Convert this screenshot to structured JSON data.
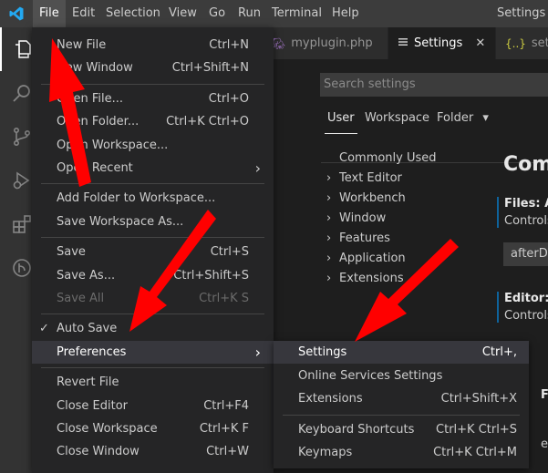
{
  "menubar": {
    "items": [
      "File",
      "Edit",
      "Selection",
      "View",
      "Go",
      "Run",
      "Terminal",
      "Help"
    ],
    "window_title": "Settings - "
  },
  "activity_bar": {
    "icons": [
      "explorer-icon",
      "search-icon",
      "source-control-icon",
      "run-debug-icon",
      "extensions-icon",
      "remote-icon"
    ]
  },
  "tabs": [
    {
      "label": "myplugin.php",
      "icon": "php-icon",
      "active": false
    },
    {
      "label": "Settings",
      "icon": "settings-file-icon",
      "active": true,
      "close": "✕"
    },
    {
      "label": "sett",
      "icon": "json-icon",
      "icon_text": "{..}",
      "active": false
    }
  ],
  "settings": {
    "search_placeholder": "Search settings",
    "scopes": [
      "User",
      "Workspace",
      "Folder"
    ],
    "folder_chevron": "▾",
    "toc": [
      {
        "label": "Commonly Used",
        "expandable": false
      },
      {
        "label": "Text Editor",
        "expandable": true
      },
      {
        "label": "Workbench",
        "expandable": true
      },
      {
        "label": "Window",
        "expandable": true
      },
      {
        "label": "Features",
        "expandable": true
      },
      {
        "label": "Application",
        "expandable": true
      },
      {
        "label": "Extensions",
        "expandable": true
      }
    ],
    "heading": "Com",
    "entries": [
      {
        "title": "Files: Au",
        "desc": "Controls",
        "value": "afterDe"
      },
      {
        "title": "Editor: F",
        "desc": "Controls"
      }
    ],
    "partial_f": "F",
    "partial_e": "e"
  },
  "file_menu": {
    "items": [
      {
        "label": "New File",
        "shortcut": "Ctrl+N"
      },
      {
        "label": "New Window",
        "shortcut": "Ctrl+Shift+N"
      },
      {
        "sep": true
      },
      {
        "label": "Open File...",
        "shortcut": "Ctrl+O"
      },
      {
        "label": "Open Folder...",
        "shortcut": "Ctrl+K Ctrl+O"
      },
      {
        "label": "Open Workspace...",
        "shortcut": ""
      },
      {
        "label": "Open Recent",
        "submenu": true
      },
      {
        "sep": true
      },
      {
        "label": "Add Folder to Workspace...",
        "shortcut": ""
      },
      {
        "label": "Save Workspace As...",
        "shortcut": ""
      },
      {
        "sep": true
      },
      {
        "label": "Save",
        "shortcut": "Ctrl+S"
      },
      {
        "label": "Save As...",
        "shortcut": "Ctrl+Shift+S"
      },
      {
        "label": "Save All",
        "shortcut": "Ctrl+K S",
        "disabled": true
      },
      {
        "sep": true
      },
      {
        "label": "Auto Save",
        "checked": true
      },
      {
        "label": "Preferences",
        "submenu": true,
        "highlighted": true
      },
      {
        "sep": true
      },
      {
        "label": "Revert File",
        "shortcut": ""
      },
      {
        "label": "Close Editor",
        "shortcut": "Ctrl+F4"
      },
      {
        "label": "Close Workspace",
        "shortcut": "Ctrl+K F"
      },
      {
        "label": "Close Window",
        "shortcut": "Ctrl+W"
      }
    ]
  },
  "preferences_menu": {
    "items": [
      {
        "label": "Settings",
        "shortcut": "Ctrl+,",
        "highlighted": true
      },
      {
        "label": "Online Services Settings",
        "shortcut": ""
      },
      {
        "label": "Extensions",
        "shortcut": "Ctrl+Shift+X"
      },
      {
        "sep": true
      },
      {
        "label": "Keyboard Shortcuts",
        "shortcut": "Ctrl+K Ctrl+S"
      },
      {
        "label": "Keymaps",
        "shortcut": "Ctrl+K Ctrl+M"
      }
    ]
  },
  "annotation_color": "#ff0000",
  "theme": {
    "accent": "#0e639c",
    "menu_bg": "#252526",
    "titlebar_bg": "#3c3c3c",
    "highlight_bg": "#094771"
  }
}
